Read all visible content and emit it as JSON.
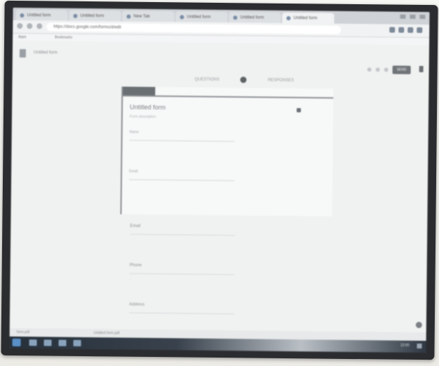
{
  "browser": {
    "tabs": [
      {
        "label": "Untitled form"
      },
      {
        "label": "Untitled form"
      },
      {
        "label": "New Tab"
      },
      {
        "label": "Untitled form"
      },
      {
        "label": "Untitled form"
      },
      {
        "label": "Untitled form"
      }
    ],
    "address": "https://docs.google.com/forms/d/edit",
    "bookmarks": [
      "Apps",
      "Bookmarks"
    ]
  },
  "page": {
    "doc_title": "Untitled form",
    "send_label": "SEND",
    "tabs": [
      "QUESTIONS",
      "RESPONSES"
    ],
    "form": {
      "theme_tab": "",
      "title": "Untitled form",
      "description": "Form description",
      "fields": [
        "Name",
        "Email"
      ]
    },
    "questions": [
      "Email",
      "Phone",
      "Address"
    ]
  },
  "downloads": {
    "items": [
      "form.pdf",
      "Untitled form.pdf"
    ]
  },
  "taskbar": {
    "clock": "12:00"
  },
  "colors": {
    "accent": "#6a6f73",
    "screen_bg": "#e9ebec"
  }
}
